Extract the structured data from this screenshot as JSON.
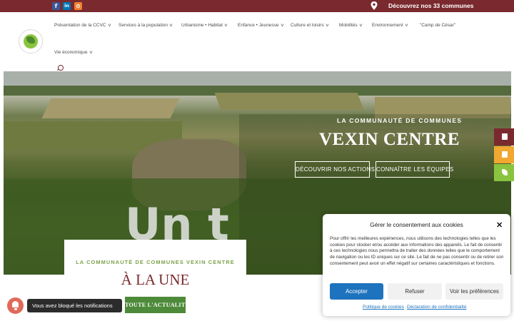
{
  "topbar": {
    "social": [
      {
        "name": "facebook-icon",
        "glyph": "f",
        "color": "#3b5998"
      },
      {
        "name": "linkedin-icon",
        "glyph": "in",
        "color": "#0077b5"
      },
      {
        "name": "rss-icon",
        "glyph": "⊙",
        "color": "#ee802f"
      }
    ],
    "communes_link": "Découvrez nos 33 communes",
    "bg": "#7a2a2e"
  },
  "nav": {
    "items": [
      "Présentation de la CCVC",
      "Services à la population",
      "Urbanisme • Habitat",
      "Enfance • Jeunesse",
      "Culture et loisirs",
      "Mobilités",
      "Environnement",
      "\"Camp de César\"",
      "Vie économique"
    ]
  },
  "hero": {
    "subtitle": "LA COMMUNAUTÉ DE COMMUNES",
    "title": "VEXIN CENTRE",
    "btn_actions": "DÉCOUVRIR NOS ACTIONS",
    "btn_teams": "CONNAÎTRE LES ÉQUIPES",
    "overlay_text": "Un t"
  },
  "side_tabs": [
    {
      "name": "side-tab-1-icon",
      "color": "#7a2a2e"
    },
    {
      "name": "side-tab-2-icon",
      "color": "#f0a830"
    },
    {
      "name": "side-tab-3-icon",
      "color": "#8ac43f"
    }
  ],
  "la_une": {
    "subtitle": "LA COMMUNAUTÉ DE COMMUNES VEXIN CENTRE",
    "title": "À LA UNE",
    "button": "TOUTE L'ACTUALITÉ"
  },
  "notification": {
    "text": "Vous avez bloqué les notifications"
  },
  "consent": {
    "title": "Gérer le consentement aux cookies",
    "body": "Pour offrir les meilleures expériences, nous utilisons des technologies telles que les cookies pour stocker et/ou accéder aux informations des appareils. Le fait de consentir à ces technologies nous permettra de traiter des données telles que le comportement de navigation ou les ID uniques sur ce site. Le fait de ne pas consentir ou de retirer son consentement peut avoir un effet négatif sur certaines caractéristiques et fonctions.",
    "accept": "Accepter",
    "refuse": "Refuser",
    "prefs": "Voir les préférences",
    "link_cookies": "Politique de cookies",
    "link_privacy": "Déclaration de confidentialité",
    "accent": "#1e73be"
  }
}
